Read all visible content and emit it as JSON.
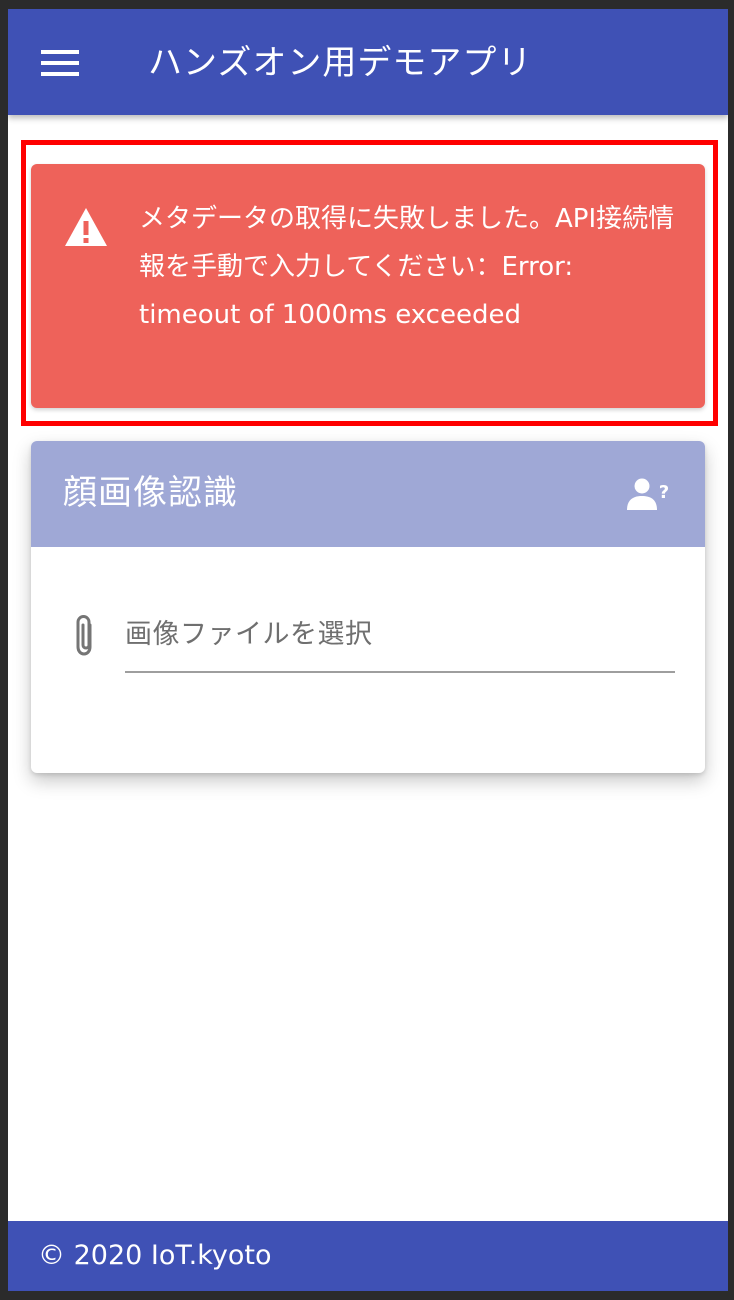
{
  "app_bar": {
    "title": "ハンズオン用デモアプリ",
    "menu_icon": "hamburger-menu-icon",
    "background": "#3f51b5"
  },
  "alert": {
    "icon": "warning-icon",
    "message": "メタデータの取得に失敗しました。API接続情報を手動で入力してください：Error: timeout of 1000ms exceeded",
    "background": "#ee625a",
    "highlight_border": "#ff0000"
  },
  "card": {
    "title": "顔画像認識",
    "header_icon": "unknown-user-icon",
    "header_background": "#9fa8d6",
    "file_input": {
      "icon": "paperclip-icon",
      "placeholder": "画像ファイルを選択"
    }
  },
  "footer": {
    "text": "© 2020 IoT.kyoto",
    "background": "#3f51b5"
  }
}
